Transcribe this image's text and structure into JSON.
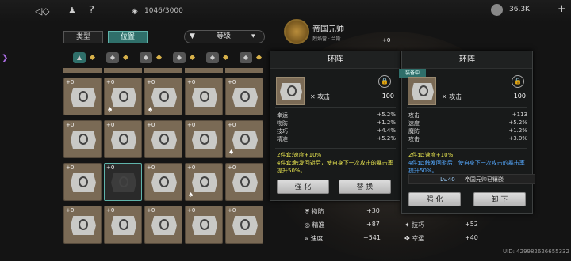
{
  "topbar": {
    "back_icon": "back-arrow-icon",
    "outfit_icon": "outfit-icon",
    "help_label": "?",
    "capacity_label": "1046/3000",
    "currency_value": "36.3K",
    "add_label": "+"
  },
  "tabs": {
    "type_label": "类型",
    "position_label": "位置",
    "filter_label": "等级"
  },
  "hero": {
    "name": "帝国元帅",
    "subtitle": "烈焰营 · 兰斯",
    "plus_label": "+0"
  },
  "grid": {
    "cells": [
      {
        "plus": "+0",
        "lock": ""
      },
      {
        "plus": "+0",
        "lock": "♠"
      },
      {
        "plus": "+0",
        "lock": "♠"
      },
      {
        "plus": "+0",
        "lock": ""
      },
      {
        "plus": "+0",
        "lock": ""
      },
      {
        "plus": "+0",
        "lock": ""
      },
      {
        "plus": "+0",
        "lock": ""
      },
      {
        "plus": "+0",
        "lock": ""
      },
      {
        "plus": "+0",
        "lock": ""
      },
      {
        "plus": "+0",
        "lock": "♠"
      },
      {
        "plus": "+0",
        "lock": ""
      },
      {
        "plus": "+0",
        "lock": ""
      },
      {
        "plus": "+0",
        "lock": ""
      },
      {
        "plus": "+0",
        "lock": "♠"
      },
      {
        "plus": "+0",
        "lock": ""
      },
      {
        "plus": "+0",
        "lock": ""
      },
      {
        "plus": "+0",
        "lock": ""
      },
      {
        "plus": "+0",
        "lock": ""
      },
      {
        "plus": "+0",
        "lock": ""
      },
      {
        "plus": "+0",
        "lock": ""
      }
    ]
  },
  "panel_left": {
    "title": "环阵",
    "main_stat": "攻击",
    "main_value": "100",
    "stats": [
      {
        "name": "幸运",
        "value": "+5.2%"
      },
      {
        "name": "物防",
        "value": "+1.2%"
      },
      {
        "name": "技巧",
        "value": "+4.4%"
      },
      {
        "name": "精准",
        "value": "+5.2%"
      }
    ],
    "set_line1": "2件套:速度+10%",
    "set_line2": "4件套:触发回避后，使自身下一次攻击的暴击率提升50%。",
    "btn_enhance": "强 化",
    "btn_replace": "替 换"
  },
  "panel_right": {
    "title": "环阵",
    "equipped_tag": "装备中",
    "main_stat": "攻击",
    "main_value": "100",
    "stats": [
      {
        "name": "攻击",
        "value": "+113"
      },
      {
        "name": "速度",
        "value": "+5.2%"
      },
      {
        "name": "魔防",
        "value": "+1.2%"
      },
      {
        "name": "攻击",
        "value": "+3.0%"
      }
    ],
    "set_line1": "2件套:速度+10%",
    "set_line2": "4件套:触发回避后，使自身下一次攻击的暴击率提升50%。",
    "level_label": "Lv.40",
    "equipped_by": "帝国元帅已镶嵌",
    "btn_enhance": "强 化",
    "btn_unload": "卸 下"
  },
  "lower_stats": [
    {
      "name": "物防",
      "value": "+30"
    },
    {
      "name": "精准",
      "value": "+87"
    },
    {
      "name": "技巧",
      "value": "+52"
    },
    {
      "name": "速度",
      "value": "+541"
    },
    {
      "name": "幸运",
      "value": "+40"
    }
  ],
  "uid": "UID: 429982626655332"
}
